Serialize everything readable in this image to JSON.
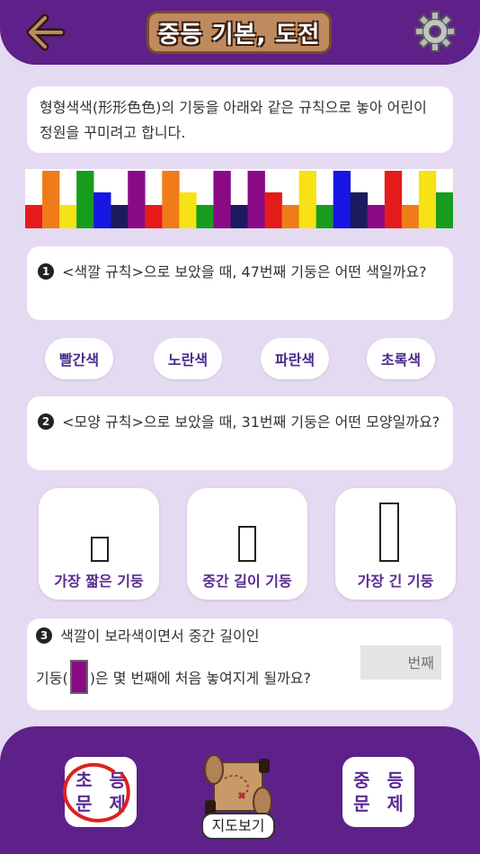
{
  "header": {
    "title": "중등 기본, 도전"
  },
  "intro": {
    "text": "형형색색(形形色色)의 기둥을 아래와 같은 규칙으로 놓아 어린이 정원을 꾸미려고 합니다."
  },
  "pillars": [
    {
      "color": "#e51b1b",
      "size": "short"
    },
    {
      "color": "#f07b19",
      "size": "long"
    },
    {
      "color": "#f7e215",
      "size": "short"
    },
    {
      "color": "#179c1e",
      "size": "long"
    },
    {
      "color": "#1717e5",
      "size": "mid"
    },
    {
      "color": "#1d1b5e",
      "size": "short"
    },
    {
      "color": "#8a0a86",
      "size": "long"
    },
    {
      "color": "#e51b1b",
      "size": "short"
    },
    {
      "color": "#f07b19",
      "size": "long"
    },
    {
      "color": "#f7e215",
      "size": "mid"
    },
    {
      "color": "#179c1e",
      "size": "short"
    },
    {
      "color": "#8a0a86",
      "size": "long"
    },
    {
      "color": "#1d1b5e",
      "size": "short"
    },
    {
      "color": "#8a0a86",
      "size": "long"
    },
    {
      "color": "#e51b1b",
      "size": "mid"
    },
    {
      "color": "#f07b19",
      "size": "short"
    },
    {
      "color": "#f7e215",
      "size": "long"
    },
    {
      "color": "#179c1e",
      "size": "short"
    },
    {
      "color": "#1717e5",
      "size": "long"
    },
    {
      "color": "#1d1b5e",
      "size": "mid"
    },
    {
      "color": "#8a0a86",
      "size": "short"
    },
    {
      "color": "#e51b1b",
      "size": "long"
    },
    {
      "color": "#f07b19",
      "size": "short"
    },
    {
      "color": "#f7e215",
      "size": "long"
    },
    {
      "color": "#179c1e",
      "size": "mid"
    }
  ],
  "q1": {
    "num": "1",
    "text": "<색깔 규칙>으로 보았을 때, 47번째 기둥은 어떤 색일까요?"
  },
  "color_options": [
    "빨간색",
    "노란색",
    "파란색",
    "초록색"
  ],
  "q2": {
    "num": "2",
    "text": "<모양 규칙>으로 보았을 때, 31번째 기둥은 어떤 모양일까요?"
  },
  "shape_options": [
    "가장 짧은 기둥",
    "중간 길이 기둥",
    "가장 긴 기둥"
  ],
  "q3": {
    "num": "3",
    "line1": "색깔이 보라색이면서 중간 길이인",
    "line2_pre": "기둥(",
    "line2_post": ")은 몇 번째에 처음 놓여지게 될까요?",
    "answer_placeholder": "번째"
  },
  "bottom": {
    "elementary": [
      "초 등",
      "문 제"
    ],
    "middle": [
      "중 등",
      "문 제"
    ],
    "map_label": "지도보기"
  }
}
